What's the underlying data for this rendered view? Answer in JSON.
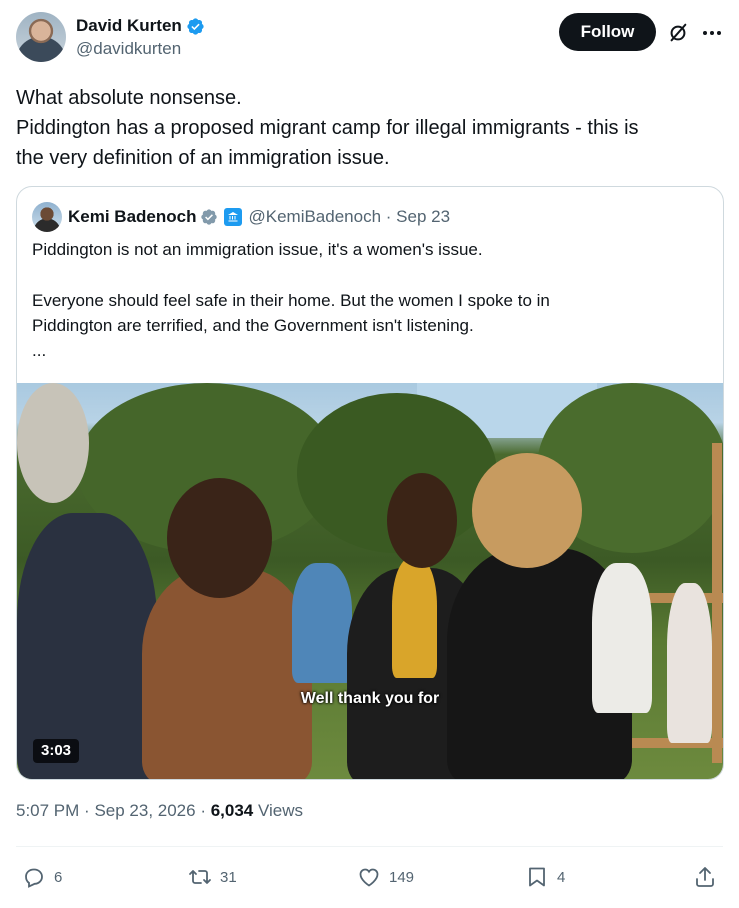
{
  "author": {
    "display_name": "David Kurten",
    "handle": "@davidkurten"
  },
  "header": {
    "follow_label": "Follow",
    "grok_icon": "grok-icon",
    "more_icon": "more-icon"
  },
  "tweet": {
    "lines": [
      "What absolute nonsense.",
      "Piddington has a proposed migrant camp for illegal immigrants - this is",
      "the very definition of an immigration issue."
    ]
  },
  "quote": {
    "display_name": "Kemi Badenoch",
    "handle_date": "@KemiBadenoch · Sep 23",
    "line1": "Piddington is not an immigration issue, it's a women's issue.",
    "line2": "Everyone should feel safe in their home. But the women I spoke to in",
    "line3": "Piddington are terrified, and the Government isn't listening.",
    "line4": "...",
    "video_caption": "Well thank you for",
    "video_duration": "3:03"
  },
  "meta": {
    "time": "5:07 PM",
    "date": "Sep 23, 2026",
    "views_count": "6,034",
    "views_label": "Views"
  },
  "actions": {
    "replies": "6",
    "reposts": "31",
    "likes": "149",
    "bookmarks": "4"
  },
  "colors": {
    "verified_blue": "#1d9bf0",
    "text_primary": "#0f1419",
    "text_secondary": "#536471",
    "border": "#cfd9de"
  }
}
